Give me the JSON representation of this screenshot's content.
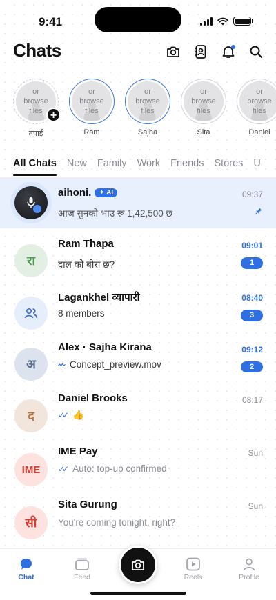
{
  "status": {
    "time": "9:41"
  },
  "header": {
    "title": "Chats"
  },
  "stories": [
    {
      "label": "तपाईं",
      "placeholder": [
        "or",
        "browse",
        "files"
      ],
      "add": "+"
    },
    {
      "label": "Ram",
      "placeholder": [
        "or",
        "browse",
        "files"
      ]
    },
    {
      "label": "Sajha",
      "placeholder": [
        "or",
        "browse",
        "files"
      ]
    },
    {
      "label": "Sita",
      "placeholder": [
        "or",
        "browse",
        "files"
      ]
    },
    {
      "label": "Daniel",
      "placeholder": [
        "or",
        "browse",
        "files"
      ]
    }
  ],
  "tabs": [
    "All Chats",
    "New",
    "Family",
    "Work",
    "Friends",
    "Stores",
    "U"
  ],
  "chats": [
    {
      "name": "aihoni.",
      "tag": "✦ AI",
      "preview": "आज सुनको भाउ रू 1,42,500 छ",
      "time": "09:37"
    },
    {
      "name": "Ram Thapa",
      "avatar": "रा",
      "preview": "दाल को बोरा छ?",
      "time": "09:01",
      "badge": "1"
    },
    {
      "name": "Lagankhel व्यापारी",
      "preview": "8 members",
      "time": "08:40",
      "badge": "3"
    },
    {
      "name": "Alex · Sajha Kirana",
      "avatar": "अ",
      "preview": "Concept_preview.mov",
      "time": "09:12",
      "badge": "2"
    },
    {
      "name": "Daniel Brooks",
      "avatar": "द",
      "preview": "👍",
      "time": "08:17"
    },
    {
      "name": "IME Pay",
      "avatar": "IME",
      "preview": "Auto: top-up confirmed",
      "time": "Sun"
    },
    {
      "name": "Sita Gurung",
      "avatar": "सी",
      "preview": "You're coming tonight, right?",
      "time": "Sun"
    }
  ],
  "nav": {
    "chat": "Chat",
    "feed": "Feed",
    "reels": "Reels",
    "profile": "Profile"
  },
  "colors": {
    "accent": "#2f6fe4",
    "pinned_bg": "#e8f0fd"
  }
}
